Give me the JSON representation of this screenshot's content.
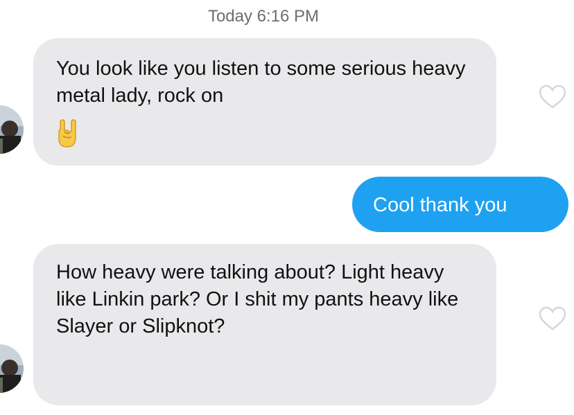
{
  "conversation": {
    "timestamp": "Today 6:16 PM",
    "messages": [
      {
        "direction": "incoming",
        "text": "You look like you listen to some serious heavy metal lady, rock on",
        "emoji": "rock-on-hand-emoji"
      },
      {
        "direction": "outgoing",
        "text": "Cool thank you"
      },
      {
        "direction": "incoming",
        "text": "How heavy were talking about? Light heavy like Linkin park? Or I shit my pants heavy like Slayer or Slipknot?"
      }
    ]
  },
  "colors": {
    "incoming_bubble": "#e9e9ec",
    "outgoing_bubble": "#1ea1f1",
    "timestamp": "#6d6d72"
  },
  "icons": [
    "heart-outline-icon",
    "rock-on-hand-emoji",
    "avatar"
  ]
}
